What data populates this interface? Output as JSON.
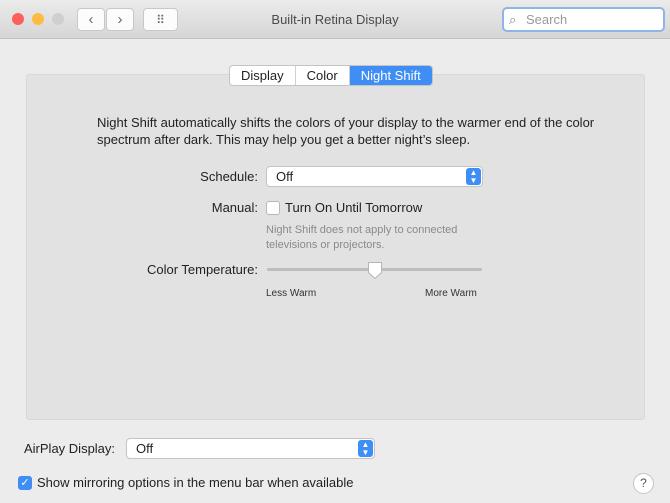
{
  "window": {
    "title": "Built-in Retina Display",
    "search_placeholder": "Search",
    "nav_back": "‹",
    "nav_forward": "›",
    "grid": "⠿"
  },
  "tabs": [
    {
      "label": "Display"
    },
    {
      "label": "Color"
    },
    {
      "label": "Night Shift",
      "active": true
    }
  ],
  "night_shift": {
    "description": "Night Shift automatically shifts the colors of your display to the warmer end of the color spectrum after dark. This may help you get a better night’s sleep.",
    "schedule_label": "Schedule:",
    "schedule_value": "Off",
    "manual_label": "Manual:",
    "manual_checkbox_label": "Turn On Until Tomorrow",
    "manual_checked": false,
    "note": "Night Shift does not apply to connected televisions or projectors.",
    "temperature_label": "Color Temperature:",
    "temperature_min_label": "Less Warm",
    "temperature_max_label": "More Warm",
    "temperature_value": 0.5
  },
  "airplay": {
    "label": "AirPlay Display:",
    "value": "Off"
  },
  "mirroring": {
    "label": "Show mirroring options in the menu bar when available",
    "checked": true
  },
  "help": "?",
  "colors": {
    "accent": "#3f8ef6"
  }
}
